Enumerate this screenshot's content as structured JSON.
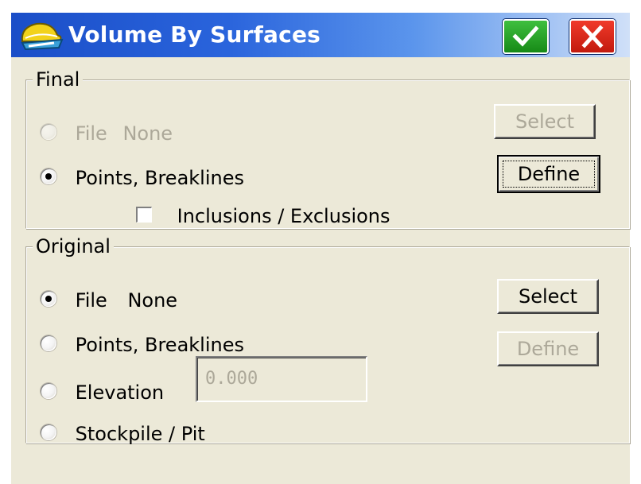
{
  "window": {
    "title": "Volume By Surfaces",
    "icons": {
      "app": "hardhat-logo-icon",
      "ok": "checkmark-icon",
      "close": "close-x-icon"
    },
    "colors": {
      "titlebar": "#2a64dc",
      "ok_button": "#1f9a1f",
      "close_button": "#d8261a",
      "face": "#ece9d8",
      "disabled_text": "#aca899"
    }
  },
  "final": {
    "legend": "Final",
    "file_option": {
      "label": "File",
      "value": "None",
      "checked": false,
      "enabled": false
    },
    "points_option": {
      "label": "Points, Breaklines",
      "checked": true,
      "enabled": true
    },
    "inclusions": {
      "label": "Inclusions / Exclusions",
      "checked": false
    },
    "select_button": {
      "label": "Select",
      "enabled": false
    },
    "define_button": {
      "label": "Define",
      "enabled": true,
      "default": true
    }
  },
  "original": {
    "legend": "Original",
    "file_option": {
      "label": "File",
      "value": "None",
      "checked": true,
      "enabled": true
    },
    "points_option": {
      "label": "Points, Breaklines",
      "checked": false
    },
    "elevation_option": {
      "label": "Elevation",
      "checked": false
    },
    "elevation_value": "0.000",
    "stockpile_option": {
      "label": "Stockpile / Pit",
      "checked": false
    },
    "select_button": {
      "label": "Select",
      "enabled": true
    },
    "define_button": {
      "label": "Define",
      "enabled": false
    }
  }
}
